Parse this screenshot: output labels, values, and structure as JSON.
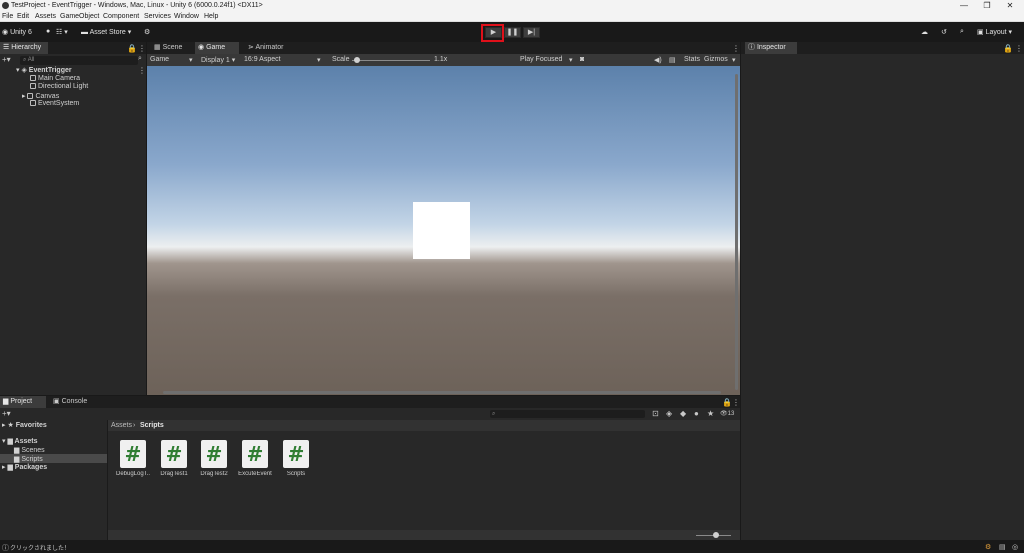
{
  "window": {
    "title": "TestProject - EventTrigger - Windows, Mac, Linux - Unity 6 (6000.0.24f1) <DX11>",
    "minimize": "—",
    "maximize": "❐",
    "close": "✕"
  },
  "menu": [
    "File",
    "Edit",
    "Assets",
    "GameObject",
    "Component",
    "Services",
    "Window",
    "Help"
  ],
  "toolbar": {
    "unity_label": "Unity 6",
    "asset_store": "Asset Store",
    "play": "▶",
    "pause": "❚❚",
    "step": "▶|",
    "layout": "Layout"
  },
  "hierarchy": {
    "tab": "Hierarchy",
    "search_placeholder": "All",
    "scene": "EventTrigger",
    "items": [
      "Main Camera",
      "Directional Light",
      "Canvas",
      "EventSystem"
    ]
  },
  "center_tabs": [
    "Scene",
    "Game",
    "Animator"
  ],
  "game_toolbar": {
    "mode": "Game",
    "display": "Display 1",
    "aspect": "16:9 Aspect",
    "scale_label": "Scale",
    "scale_value": "1.1x",
    "play_focused": "Play Focused",
    "stats": "Stats",
    "gizmos": "Gizmos"
  },
  "inspector": {
    "tab": "Inspector"
  },
  "bottom_tabs": [
    "Project",
    "Console"
  ],
  "project": {
    "favorites": "Favorites",
    "assets": "Assets",
    "scenes": "Scenes",
    "scripts": "Scripts",
    "packages": "Packages",
    "breadcrumb_root": "Assets",
    "breadcrumb_current": "Scripts",
    "count": "13",
    "files": [
      "DebugLogT...",
      "DragTest1",
      "DragTest2",
      "ExcuteEvent",
      "Scripts"
    ],
    "file_glyph": "#"
  },
  "status": {
    "message": "クリックされました！"
  }
}
